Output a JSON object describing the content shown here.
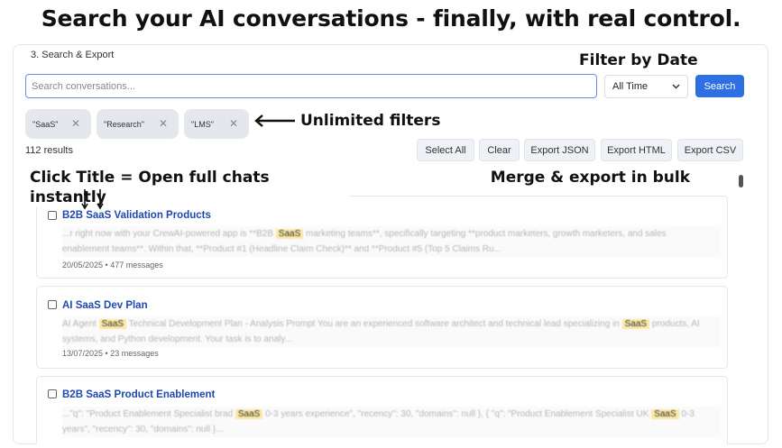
{
  "headline": "Search your AI conversations - finally, with real control.",
  "section_title": "3. Search & Export",
  "annotations": {
    "filter_by_date": "Filter by Date",
    "unlimited_filters": "Unlimited filters",
    "click_title": "Click Title = Open full chats instantly",
    "merge_export": "Merge & export in bulk"
  },
  "search": {
    "placeholder": "Search conversations...",
    "value": ""
  },
  "date_filter": {
    "selected": "All Time",
    "icon": "chevron-down-icon"
  },
  "search_button": "Search",
  "chips": [
    {
      "label": "\"SaaS\""
    },
    {
      "label": "\"Research\""
    },
    {
      "label": "\"LMS\""
    }
  ],
  "results_count": "112 results",
  "toolbar": {
    "select_all": "Select All",
    "clear": "Clear",
    "export_json": "Export JSON",
    "export_html": "Export HTML",
    "export_csv": "Export CSV"
  },
  "results": [
    {
      "title": "B2B SaaS Validation Products",
      "snippet_1a": "...r right now with your CrewAI-powered app is **B2B ",
      "snippet_1hl": "SaaS",
      "snippet_1b": " marketing teams**, specifically targeting **product marketers, growth marketers, and sales",
      "snippet_2a": "enablement teams**. Within that, **Product #1 (Headline Claim Check)** and **Product #5 (Top 5 Claims Ru...",
      "snippet_2hl": "",
      "snippet_2b": "",
      "meta": "20/05/2025 • 477 messages"
    },
    {
      "title": "AI SaaS Dev Plan",
      "snippet_1a": "AI Agent ",
      "snippet_1hl": "SaaS",
      "snippet_1b": " Technical Development Plan - Analysis Prompt You are an experienced software architect and technical lead specializing in ",
      "snippet_1hl2": "SaaS",
      "snippet_1c": " products, AI",
      "snippet_2a": "systems, and Python development. Your task is to analy...",
      "meta": "13/07/2025 • 23 messages"
    },
    {
      "title": "B2B SaaS Product Enablement",
      "snippet_1a": "...\"q\": \"Product Enablement Specialist brad ",
      "snippet_1hl": "SaaS",
      "snippet_1b": " 0-3 years experience\", \"recency\": 30, \"domains\": null }, { \"q\": \"Product Enablement Specialist UK ",
      "snippet_1hl2": "SaaS",
      "snippet_1c": " 0-3",
      "snippet_2a": "years\", \"recency\": 30, \"domains\": null }...",
      "meta": ""
    }
  ]
}
